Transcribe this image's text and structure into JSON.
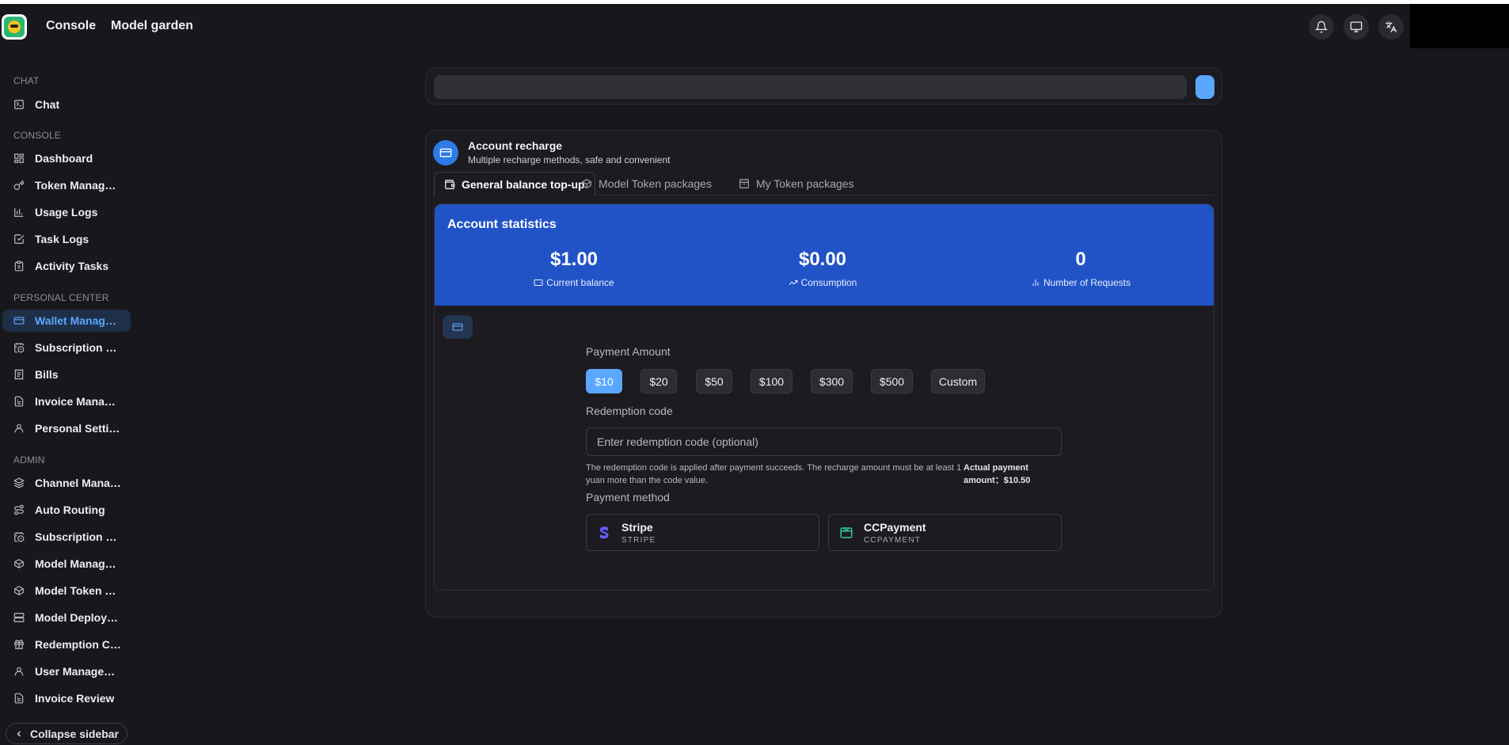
{
  "header": {
    "nav": [
      "Console",
      "Model garden"
    ],
    "icons": [
      "bell-icon",
      "monitor-icon",
      "translate-icon"
    ]
  },
  "sidebar": {
    "sections": {
      "chat": "CHAT",
      "console": "CONSOLE",
      "personal": "PERSONAL CENTER",
      "admin": "ADMIN"
    },
    "items": [
      {
        "label": "Chat",
        "icon": "chat-icon"
      },
      {
        "label": "Dashboard",
        "icon": "dashboard-icon"
      },
      {
        "label": "Token Management",
        "icon": "key-icon"
      },
      {
        "label": "Usage Logs",
        "icon": "bar-chart-icon"
      },
      {
        "label": "Task Logs",
        "icon": "check-square-icon"
      },
      {
        "label": "Activity Tasks",
        "icon": "clipboard-icon"
      },
      {
        "label": "Wallet Management",
        "icon": "wallet-icon"
      },
      {
        "label": "Subscription Plans",
        "icon": "calendar-clock-icon"
      },
      {
        "label": "Bills",
        "icon": "receipt-icon"
      },
      {
        "label": "Invoice Management",
        "icon": "file-text-icon"
      },
      {
        "label": "Personal Settings",
        "icon": "user-icon"
      },
      {
        "label": "Channel Management",
        "icon": "layers-icon"
      },
      {
        "label": "Auto Routing",
        "icon": "route-icon"
      },
      {
        "label": "Subscription Management",
        "icon": "calendar-clock-icon"
      },
      {
        "label": "Model Management",
        "icon": "box-icon"
      },
      {
        "label": "Model Token packages",
        "icon": "box-icon"
      },
      {
        "label": "Model Deployment",
        "icon": "server-icon"
      },
      {
        "label": "Redemption Codes",
        "icon": "gift-icon"
      },
      {
        "label": "User Management",
        "icon": "user-icon"
      },
      {
        "label": "Invoice Review",
        "icon": "file-text-icon"
      }
    ],
    "collapse": "Collapse sidebar"
  },
  "recharge": {
    "title": "Account recharge",
    "subtitle": "Multiple recharge methods, safe and convenient",
    "tabs": [
      "General balance top-up",
      "Model Token packages",
      "My Token packages"
    ],
    "stats": {
      "title": "Account statistics",
      "items": [
        {
          "value": "$1.00",
          "label": "Current balance"
        },
        {
          "value": "$0.00",
          "label": "Consumption"
        },
        {
          "value": "0",
          "label": "Number of Requests"
        }
      ]
    },
    "payment_amount_label": "Payment Amount",
    "amounts": [
      "$10",
      "$20",
      "$50",
      "$100",
      "$300",
      "$500",
      "Custom"
    ],
    "selected_amount": "$10",
    "redemption_label": "Redemption code",
    "redemption_placeholder": "Enter redemption code (optional)",
    "redemption_note": "The redemption code is applied after payment succeeds. The recharge amount must be at least 1 yuan more than the code value.",
    "actual_payment": "Actual payment amount：$10.50",
    "payment_method_label": "Payment method",
    "methods": [
      {
        "name": "Stripe",
        "sub": "STRIPE",
        "color": "#635bff"
      },
      {
        "name": "CCPayment",
        "sub": "CCPAYMENT",
        "color": "#2fc7a6"
      }
    ]
  },
  "colors": {
    "accent": "#5ba6ff",
    "stats_bg": "#2253c6",
    "background": "#18181c"
  }
}
